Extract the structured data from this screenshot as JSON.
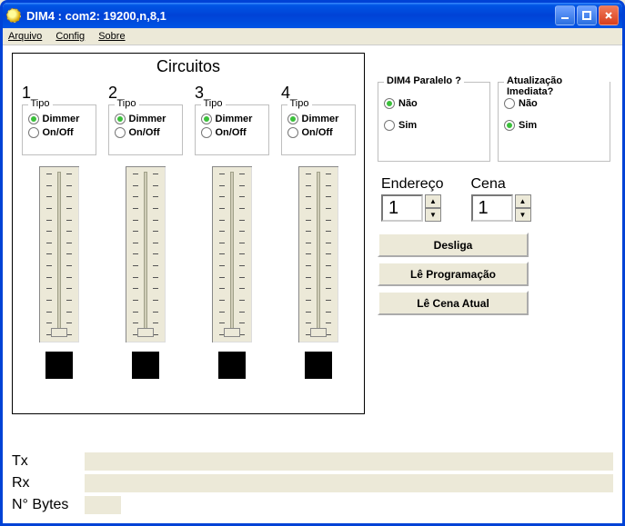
{
  "window": {
    "title": "DIM4 : com2: 19200,n,8,1"
  },
  "menu": {
    "arquivo": "Arquivo",
    "config": "Config",
    "sobre": "Sobre"
  },
  "circuits": {
    "title": "Circuitos",
    "tipo_label": "Tipo",
    "dimmer_label": "Dimmer",
    "onoff_label": "On/Off",
    "items": [
      {
        "num": "1",
        "tipo": "Dimmer",
        "thumb_bottom": 6
      },
      {
        "num": "2",
        "tipo": "Dimmer",
        "thumb_bottom": 6
      },
      {
        "num": "3",
        "tipo": "Dimmer",
        "thumb_bottom": 6
      },
      {
        "num": "4",
        "tipo": "Dimmer",
        "thumb_bottom": 6
      }
    ]
  },
  "paralelo": {
    "title": "DIM4 Paralelo ?",
    "nao": "Não",
    "sim": "Sim",
    "selected": "Não"
  },
  "atualiza": {
    "title": "Atualização Imediata?",
    "nao": "Não",
    "sim": "Sim",
    "selected": "Sim"
  },
  "endereco": {
    "label": "Endereço",
    "value": "1"
  },
  "cena": {
    "label": "Cena",
    "value": "1"
  },
  "buttons": {
    "desliga": "Desliga",
    "le_prog": "Lê Programação",
    "le_cena": "Lê Cena Atual"
  },
  "status": {
    "tx_label": "Tx",
    "rx_label": "Rx",
    "nbytes_label": "N° Bytes",
    "tx_value": "",
    "rx_value": "",
    "nbytes_value": ""
  }
}
